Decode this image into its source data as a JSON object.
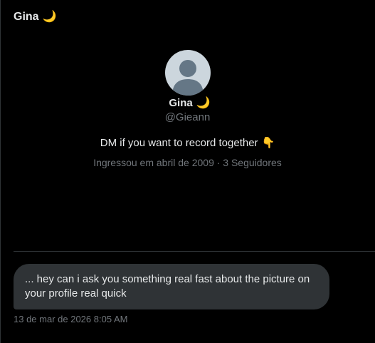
{
  "header": {
    "title": "Gina",
    "title_emoji": "🌙"
  },
  "profile": {
    "name": "Gina",
    "name_emoji": "🌙",
    "handle": "@Gieann",
    "bio": "DM if you want to record together",
    "bio_emoji": "👇",
    "meta": "Ingressou em abril de 2009 · 3 Seguidores",
    "avatar_icon": "default-avatar-icon"
  },
  "conversation": {
    "messages": [
      {
        "text": "... hey can i ask you something real fast about the picture on your profile real quick",
        "timestamp": "13 de mar de 2026 8:05 AM"
      }
    ]
  },
  "colors": {
    "background": "#000000",
    "text_primary": "#e7e9ea",
    "text_secondary": "#71767b",
    "bubble": "#2f3336",
    "divider": "#2f3336",
    "avatar_bg": "#ccd6dd",
    "avatar_fg": "#657786"
  }
}
